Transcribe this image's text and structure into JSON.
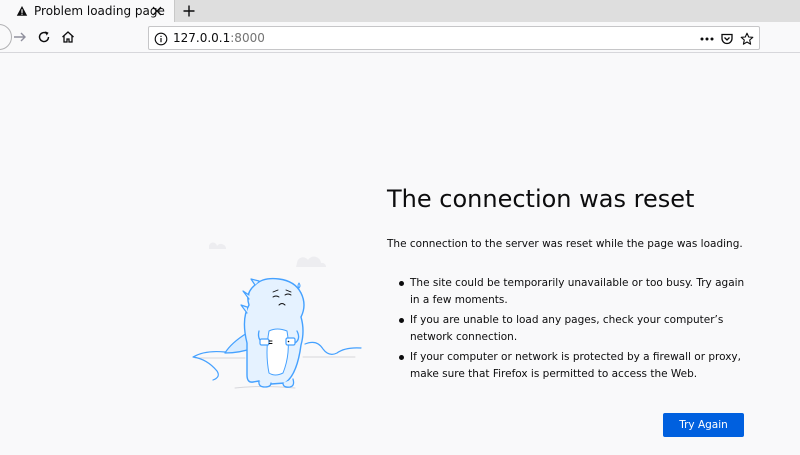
{
  "tab": {
    "title": "Problem loading page",
    "icon": "warning-icon"
  },
  "navbar": {
    "url_host": "127.0.0.1",
    "url_port": ":8000",
    "icons": [
      "back-icon",
      "forward-icon",
      "reload-icon",
      "home-icon",
      "info-icon",
      "page-actions-icon",
      "pocket-icon",
      "bookmark-star-icon"
    ]
  },
  "error": {
    "title": "The connection was reset",
    "description": "The connection to the server was reset while the page was loading.",
    "bullets": [
      "The site could be temporarily unavailable or too busy. Try again in a few moments.",
      "If you are unable to load any pages, check your computer’s network connection.",
      "If your computer or network is protected by a firewall or proxy, make sure that Firefox is permitted to access the Web."
    ],
    "button_label": "Try Again"
  },
  "colors": {
    "accent": "#0060df",
    "illustration": "#45a1ff",
    "background": "#f9f9fa"
  }
}
